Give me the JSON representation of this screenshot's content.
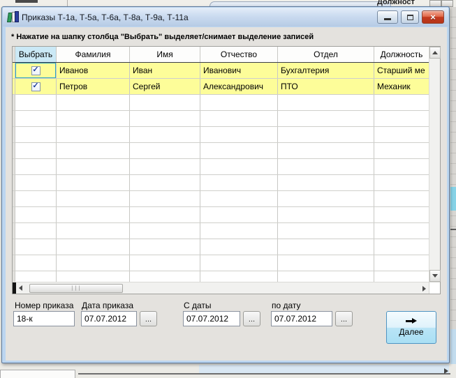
{
  "background": {
    "fragment_text": "Должност"
  },
  "window": {
    "title": "Приказы Т-1а, Т-5а, Т-6а, Т-8а, Т-9а, Т-11а",
    "note": "* Нажатие на шапку столбца \"Выбрать\" выделяет/снимает выделение записей"
  },
  "table": {
    "columns": [
      "Выбрать",
      "Фамилия",
      "Имя",
      "Отчество",
      "Отдел",
      "Должность"
    ],
    "rows": [
      {
        "checked": true,
        "last_name": "Иванов",
        "first_name": "Иван",
        "middle_name": "Иванович",
        "department": "Бухгалтерия",
        "position": "Старший ме"
      },
      {
        "checked": true,
        "last_name": "Петров",
        "first_name": "Сергей",
        "middle_name": "Александрович",
        "department": "ПТО",
        "position": "Механик"
      }
    ],
    "row_highlight_color": "#FDFD99",
    "selected_header_color": "#CBE9F6"
  },
  "form": {
    "order_number_label": "Номер приказа",
    "order_number_value": "18-к",
    "order_date_label": "Дата приказа",
    "order_date_value": "07.07.2012",
    "date_from_label": "С даты",
    "date_from_value": "07.07.2012",
    "date_to_label": "по дату",
    "date_to_value": "07.07.2012",
    "browse_label": "...",
    "next_label": "Далее"
  },
  "icons": {
    "check": "✓",
    "close": "×",
    "grip": "|||"
  }
}
